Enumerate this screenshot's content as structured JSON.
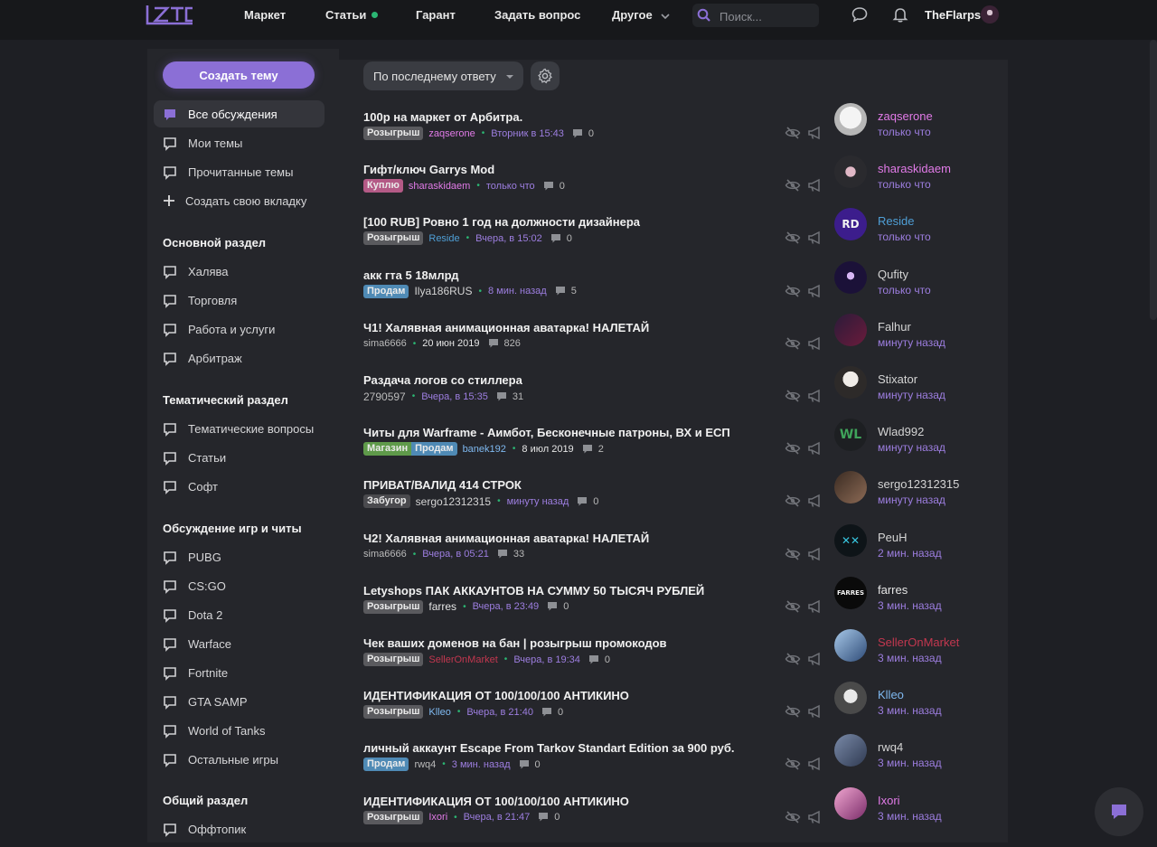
{
  "header": {
    "logo": "LZT",
    "nav": [
      "Маркет",
      "Статьи",
      "Гарант",
      "Задать вопрос",
      "Другое"
    ],
    "search_placeholder": "Поиск...",
    "username": "TheFlarps"
  },
  "sidebar": {
    "create_label": "Создать тему",
    "top_items": [
      "Все обсуждения",
      "Мои темы",
      "Прочитанные темы",
      "Создать свою вкладку"
    ],
    "sections": [
      {
        "title": "Основной раздел",
        "items": [
          "Халява",
          "Торговля",
          "Работа и услуги",
          "Арбитраж"
        ]
      },
      {
        "title": "Тематический раздел",
        "items": [
          "Тематические вопросы",
          "Статьи",
          "Софт"
        ]
      },
      {
        "title": "Обсуждение игр и читы",
        "items": [
          "PUBG",
          "CS:GO",
          "Dota 2",
          "Warface",
          "Fortnite",
          "GTA SAMP",
          "World of Tanks",
          "Остальные игры"
        ]
      },
      {
        "title": "Общий раздел",
        "items": [
          "Оффтопик"
        ]
      }
    ]
  },
  "toolbar": {
    "sort_label": "По последнему ответу"
  },
  "colors": {
    "accent": "#8b6fd6",
    "online": "#2bb673",
    "date": "#9d7ee0",
    "tag_giveaway": "#5a5a5e",
    "tag_buy": "#b45a86",
    "tag_sell": "#4f8ab5",
    "tag_shop": "#5f9a4a",
    "tag_banned": "#4a4a4e"
  },
  "threads": [
    {
      "title": "100р на маркет от Арбитра.",
      "tags": [
        "Розыгрыш"
      ],
      "author": "zaqserone",
      "date": "Вторник в 15:43",
      "replies": "0",
      "last_user": "zaqserone",
      "last_time": "только что"
    },
    {
      "title": "Гифт/ключ Garrys Mod",
      "tags": [
        "Куплю"
      ],
      "author": "sharaskidaem",
      "date": "только что",
      "replies": "0",
      "last_user": "sharaskidaem",
      "last_time": "только что"
    },
    {
      "title": "[100 RUB] Ровно 1 год на должности дизайнера",
      "tags": [
        "Розыгрыш"
      ],
      "author": "Reside",
      "date": "Вчера, в 15:02",
      "replies": "0",
      "last_user": "Reside",
      "last_time": "только что"
    },
    {
      "title": "акк гта 5 18млрд",
      "tags": [
        "Продам"
      ],
      "author": "Ilya186RUS",
      "date": "8 мин. назад",
      "replies": "5",
      "last_user": "Qufity",
      "last_time": "только что"
    },
    {
      "title": "Ч1! Халявная анимационная аватарка! НАЛЕТАЙ",
      "tags": [],
      "author": "sima6666",
      "date": "20 июн 2019",
      "replies": "826",
      "last_user": "Falhur",
      "last_time": "минуту назад"
    },
    {
      "title": "Раздача логов со стиллера",
      "tags": [],
      "author": "2790597",
      "date": "Вчера, в 15:35",
      "replies": "31",
      "last_user": "Stixator",
      "last_time": "минуту назад"
    },
    {
      "title": "Читы для Warframe - Аимбот, Бесконечные патроны, ВХ и ЕСП",
      "tags": [
        "Магазин",
        "Продам"
      ],
      "author": "banek192",
      "date": "8 июл 2019",
      "replies": "2",
      "last_user": "Wlad992",
      "last_time": "минуту назад"
    },
    {
      "title": "ПРИВАТ/ВАЛИД 414 СТРОК",
      "tags": [
        "Забугор"
      ],
      "author": "sergo12312315",
      "date": "минуту назад",
      "replies": "0",
      "last_user": "sergo12312315",
      "last_time": "минуту назад"
    },
    {
      "title": "Ч2! Халявная анимационная аватарка! НАЛЕТАЙ",
      "tags": [],
      "author": "sima6666",
      "date": "Вчера, в 05:21",
      "replies": "33",
      "last_user": "PeuH",
      "last_time": "2 мин. назад"
    },
    {
      "title": "Letyshops ПАК АККАУНТОВ НА СУММУ 50 ТЫСЯЧ РУБЛЕЙ",
      "tags": [
        "Розыгрыш"
      ],
      "author": "farres",
      "date": "Вчера, в 23:49",
      "replies": "0",
      "last_user": "farres",
      "last_time": "3 мин. назад"
    },
    {
      "title": "Чек ваших доменов на бан | розыгрыш промокодов",
      "tags": [
        "Розыгрыш"
      ],
      "author": "SellerOnMarket",
      "date": "Вчера, в 19:34",
      "replies": "0",
      "last_user": "SellerOnMarket",
      "last_time": "3 мин. назад"
    },
    {
      "title": "ИДЕНТИФИКАЦИЯ ОТ 100/100/100 АНТИКИНО",
      "tags": [
        "Розыгрыш"
      ],
      "author": "Klleo",
      "date": "Вчера, в 21:40",
      "replies": "0",
      "last_user": "Klleo",
      "last_time": "3 мин. назад"
    },
    {
      "title": "личный аккаунт Escape From Tarkov Standart Edition за 900 руб.",
      "tags": [
        "Продам"
      ],
      "author": "rwq4",
      "date": "3 мин. назад",
      "replies": "0",
      "last_user": "rwq4",
      "last_time": "3 мин. назад"
    },
    {
      "title": "ИДЕНТИФИКАЦИЯ ОТ 100/100/100 АНТИКИНО",
      "tags": [
        "Розыгрыш"
      ],
      "author": "Ixori",
      "date": "Вчера, в 21:47",
      "replies": "0",
      "last_user": "Ixori",
      "last_time": "3 мин. назад"
    }
  ]
}
